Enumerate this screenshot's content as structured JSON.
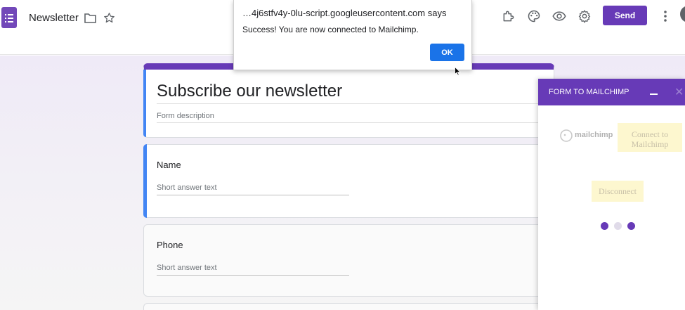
{
  "topbar": {
    "doc_title": "Newsletter",
    "send_label": "Send",
    "icons": [
      "forms-doc-icon",
      "folder-icon",
      "star-icon",
      "puzzle-icon",
      "palette-icon",
      "eye-icon",
      "gear-icon",
      "more-vert-icon"
    ]
  },
  "form": {
    "title": "Subscribe our newsletter",
    "description_placeholder": "Form description",
    "questions": [
      {
        "label": "Name",
        "placeholder": "Short answer text"
      },
      {
        "label": "Phone",
        "placeholder": "Short answer text"
      }
    ]
  },
  "alert": {
    "origin": "…4j6stfv4y-0lu-script.googleusercontent.com says",
    "message": "Success! You are now connected to Mailchimp.",
    "ok_label": "OK"
  },
  "panel": {
    "title": "FORM TO MAILCHIMP",
    "logo_text": "mailchimp",
    "connect_label": "Connect to Mailchimp",
    "disconnect_label": "Disconnect"
  },
  "colors": {
    "brand_purple": "#673ab7",
    "accent_blue": "#4285f4",
    "ok_blue": "#1a73e8",
    "loader_dot": "#673ab7",
    "loader_dot_dim": "#e0dbe9"
  }
}
